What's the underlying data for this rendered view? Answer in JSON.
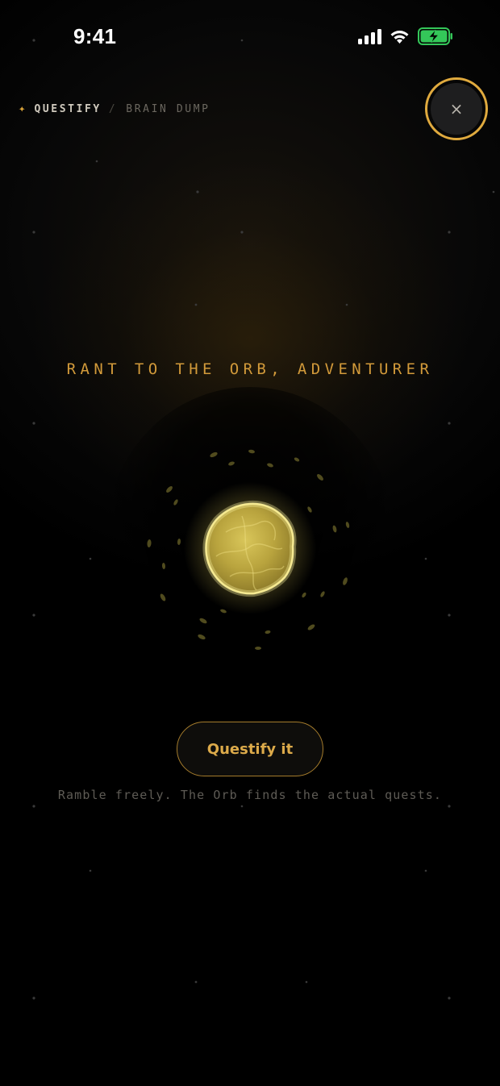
{
  "status_bar": {
    "time": "9:41",
    "icons": [
      "cellular-signal-icon",
      "wifi-icon",
      "battery-charging-icon"
    ],
    "battery_color": "#34c759"
  },
  "breadcrumb": {
    "icon": "sparkle-icon",
    "app": "QUESTIFY",
    "separator": "/",
    "page": "BRAIN DUMP"
  },
  "close_button": {
    "icon": "close-icon",
    "glyph": "×",
    "ring_color": "#e0aa3e"
  },
  "main": {
    "headline": "RANT TO THE ORB, ADVENTURER",
    "orb_icon": "glowing-orb-icon",
    "cta_label": "Questify it",
    "hint": "Ramble freely. The Orb finds the actual quests."
  },
  "colors": {
    "accent": "#d29a3a",
    "orb": "#e8d86a",
    "background": "#000000"
  }
}
